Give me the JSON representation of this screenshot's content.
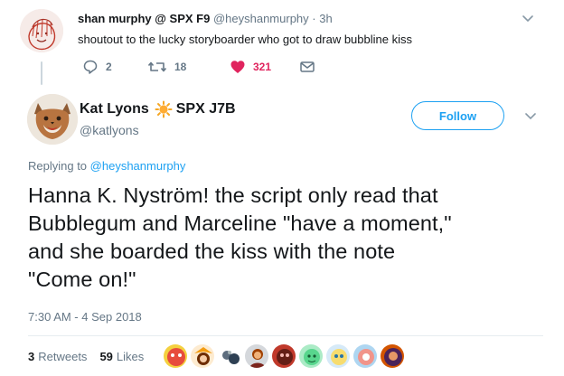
{
  "parent_tweet": {
    "name": "shan murphy @ SPX F9",
    "handle": "@heyshanmurphy",
    "separator": "·",
    "time": "3h",
    "text": "shoutout to the lucky storyboarder who got to draw bubbline kiss",
    "replies": "2",
    "retweets": "18",
    "likes": "321",
    "avatar_icon": "sketch-avatar-icon"
  },
  "main_tweet": {
    "name": "Kat Lyons",
    "name_suffix": "SPX J7B",
    "handle": "@katlyons",
    "follow_label": "Follow",
    "replying_prefix": "Replying to",
    "replying_to": "@heyshanmurphy",
    "text_lines": [
      "Hanna K. Nyström! the script only read that",
      "Bubblegum and Marceline \"have a moment,\"",
      "and she boarded the kiss with the note",
      "\"Come on!\""
    ],
    "timestamp": "7:30 AM - 4 Sep 2018",
    "retweets_count": "3",
    "retweets_label": "Retweets",
    "likes_count": "59",
    "likes_label": "Likes",
    "avatar_icon": "fox-avatar-icon"
  },
  "colors": {
    "accent": "#1da1f2",
    "like": "#e0245e",
    "muted": "#657786",
    "text": "#14171a",
    "border": "#e6ecf0"
  }
}
